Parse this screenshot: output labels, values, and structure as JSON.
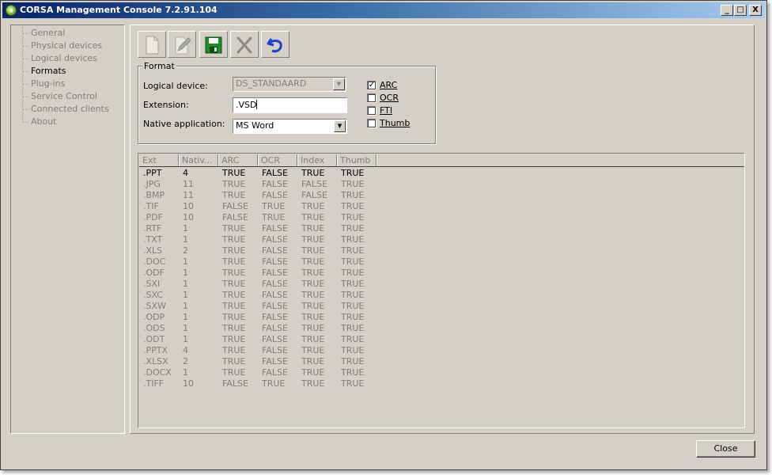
{
  "window": {
    "title": "CORSA Management Console 7.2.91.104",
    "minimize_label": "_",
    "maximize_label": "□",
    "close_label": "X"
  },
  "nav": {
    "items": [
      {
        "label": "General",
        "active": false
      },
      {
        "label": "Physical devices",
        "active": false
      },
      {
        "label": "Logical devices",
        "active": false
      },
      {
        "label": "Formats",
        "active": true
      },
      {
        "label": "Plug-ins",
        "active": false
      },
      {
        "label": "Service Control",
        "active": false
      },
      {
        "label": "Connected clients",
        "active": false
      },
      {
        "label": "About",
        "active": false
      }
    ]
  },
  "toolbar": {
    "buttons": [
      {
        "icon": "new-document-icon",
        "enabled": false
      },
      {
        "icon": "edit-pencil-icon",
        "enabled": false
      },
      {
        "icon": "save-floppy-icon",
        "enabled": true
      },
      {
        "icon": "delete-x-icon",
        "enabled": false
      },
      {
        "icon": "undo-arrow-icon",
        "enabled": true
      }
    ]
  },
  "format": {
    "legend": "Format",
    "logical_device_label": "Logical device:",
    "logical_device_value": "DS_STANDAARD",
    "extension_label": "Extension:",
    "extension_value": ".VSD",
    "native_app_label": "Native application:",
    "native_app_value": "MS Word",
    "checkboxes": [
      {
        "label": "ARC",
        "checked": true
      },
      {
        "label": "OCR",
        "checked": false
      },
      {
        "label": "FTI",
        "checked": false
      },
      {
        "label": "Thumb",
        "checked": false
      }
    ]
  },
  "table": {
    "columns": [
      "Ext",
      "Nativ...",
      "ARC",
      "OCR",
      "Index",
      "Thumb"
    ],
    "rows": [
      [
        ".PPT",
        "4",
        "TRUE",
        "FALSE",
        "TRUE",
        "TRUE"
      ],
      [
        ".JPG",
        "11",
        "TRUE",
        "FALSE",
        "FALSE",
        "TRUE"
      ],
      [
        ".BMP",
        "11",
        "TRUE",
        "FALSE",
        "FALSE",
        "TRUE"
      ],
      [
        ".TIF",
        "10",
        "FALSE",
        "TRUE",
        "TRUE",
        "TRUE"
      ],
      [
        ".PDF",
        "10",
        "FALSE",
        "TRUE",
        "TRUE",
        "TRUE"
      ],
      [
        ".RTF",
        "1",
        "TRUE",
        "FALSE",
        "TRUE",
        "TRUE"
      ],
      [
        ".TXT",
        "1",
        "TRUE",
        "FALSE",
        "TRUE",
        "TRUE"
      ],
      [
        ".XLS",
        "2",
        "TRUE",
        "FALSE",
        "TRUE",
        "TRUE"
      ],
      [
        ".DOC",
        "1",
        "TRUE",
        "FALSE",
        "TRUE",
        "TRUE"
      ],
      [
        ".ODF",
        "1",
        "TRUE",
        "FALSE",
        "TRUE",
        "TRUE"
      ],
      [
        ".SXI",
        "1",
        "TRUE",
        "FALSE",
        "TRUE",
        "TRUE"
      ],
      [
        ".SXC",
        "1",
        "TRUE",
        "FALSE",
        "TRUE",
        "TRUE"
      ],
      [
        ".SXW",
        "1",
        "TRUE",
        "FALSE",
        "TRUE",
        "TRUE"
      ],
      [
        ".ODP",
        "1",
        "TRUE",
        "FALSE",
        "TRUE",
        "TRUE"
      ],
      [
        ".ODS",
        "1",
        "TRUE",
        "FALSE",
        "TRUE",
        "TRUE"
      ],
      [
        ".ODT",
        "1",
        "TRUE",
        "FALSE",
        "TRUE",
        "TRUE"
      ],
      [
        ".PPTX",
        "4",
        "TRUE",
        "FALSE",
        "TRUE",
        "TRUE"
      ],
      [
        ".XLSX",
        "2",
        "TRUE",
        "FALSE",
        "TRUE",
        "TRUE"
      ],
      [
        ".DOCX",
        "1",
        "TRUE",
        "FALSE",
        "TRUE",
        "TRUE"
      ],
      [
        ".TIFF",
        "10",
        "FALSE",
        "TRUE",
        "TRUE",
        "TRUE"
      ]
    ],
    "selected_row": 0
  },
  "footer": {
    "close_label": "Close"
  },
  "colors": {
    "window_bg": "#d4d0c8",
    "title_gradient_start": "#0a246a",
    "title_gradient_end": "#a6caf0",
    "disabled_text": "#808080",
    "save_icon": "#1f8a2a",
    "undo_icon": "#1c3fd8"
  }
}
